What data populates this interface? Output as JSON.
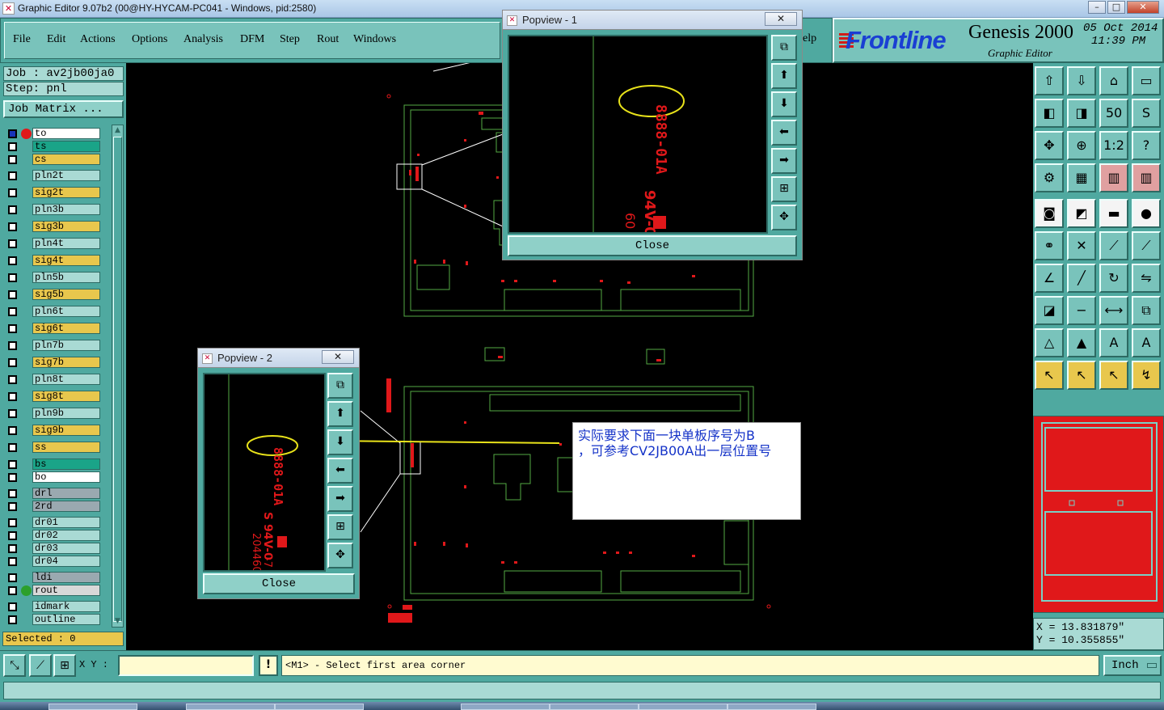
{
  "window": {
    "title": "Graphic Editor 9.07b2 (00@HY-HYCAM-PC041 - Windows, pid:2580)",
    "controls": [
      "–",
      "□",
      "✕"
    ]
  },
  "menu": {
    "items": [
      "File",
      "Edit",
      "Actions",
      "Options",
      "Analysis",
      "DFM",
      "Step",
      "Rout",
      "Windows"
    ],
    "help_fragment": "elp"
  },
  "branding": {
    "logo": "Frontline",
    "product": "Genesis 2000",
    "subtitle": "Graphic Editor",
    "date": "05 Oct 2014",
    "time": "11:39 PM"
  },
  "job": {
    "job_label": "Job : av2jb00ja0",
    "step_label": "Step: pnl",
    "matrix_button": "Job Matrix ..."
  },
  "layers": [
    {
      "name": "to",
      "color": "#ffffff",
      "active": true,
      "dot": "#e0181a"
    },
    {
      "name": "ts",
      "color": "#1aa488",
      "active": false,
      "dot": ""
    },
    {
      "name": "cs",
      "color": "#e8c74d",
      "active": false,
      "dot": ""
    },
    {
      "name": "pln2t",
      "color": "#a9dad4",
      "active": false,
      "dot": ""
    },
    {
      "name": "sig2t",
      "color": "#e8c74d",
      "active": false,
      "dot": ""
    },
    {
      "name": "pln3b",
      "color": "#a9dad4",
      "active": false,
      "dot": ""
    },
    {
      "name": "sig3b",
      "color": "#e8c74d",
      "active": false,
      "dot": ""
    },
    {
      "name": "pln4t",
      "color": "#a9dad4",
      "active": false,
      "dot": ""
    },
    {
      "name": "sig4t",
      "color": "#e8c74d",
      "active": false,
      "dot": ""
    },
    {
      "name": "pln5b",
      "color": "#a9dad4",
      "active": false,
      "dot": ""
    },
    {
      "name": "sig5b",
      "color": "#e8c74d",
      "active": false,
      "dot": ""
    },
    {
      "name": "pln6t",
      "color": "#a9dad4",
      "active": false,
      "dot": ""
    },
    {
      "name": "sig6t",
      "color": "#e8c74d",
      "active": false,
      "dot": ""
    },
    {
      "name": "pln7b",
      "color": "#a9dad4",
      "active": false,
      "dot": ""
    },
    {
      "name": "sig7b",
      "color": "#e8c74d",
      "active": false,
      "dot": ""
    },
    {
      "name": "pln8t",
      "color": "#a9dad4",
      "active": false,
      "dot": ""
    },
    {
      "name": "sig8t",
      "color": "#e8c74d",
      "active": false,
      "dot": ""
    },
    {
      "name": "pln9b",
      "color": "#a9dad4",
      "active": false,
      "dot": ""
    },
    {
      "name": "sig9b",
      "color": "#e8c74d",
      "active": false,
      "dot": ""
    },
    {
      "name": "ss",
      "color": "#e8c74d",
      "active": false,
      "dot": ""
    },
    {
      "name": "bs",
      "color": "#1aa488",
      "active": false,
      "dot": ""
    },
    {
      "name": "bo",
      "color": "#ffffff",
      "active": false,
      "dot": ""
    },
    {
      "name": "drl",
      "color": "#9aa9b0",
      "active": false,
      "dot": ""
    },
    {
      "name": "2rd",
      "color": "#9aa9b0",
      "active": false,
      "dot": ""
    },
    {
      "name": "dr01",
      "color": "#a9dad4",
      "active": false,
      "dot": ""
    },
    {
      "name": "dr02",
      "color": "#a9dad4",
      "active": false,
      "dot": ""
    },
    {
      "name": "dr03",
      "color": "#a9dad4",
      "active": false,
      "dot": ""
    },
    {
      "name": "dr04",
      "color": "#a9dad4",
      "active": false,
      "dot": ""
    },
    {
      "name": "ldi",
      "color": "#9aa9b0",
      "active": false,
      "dot": ""
    },
    {
      "name": "rout",
      "color": "#d8d8d8",
      "active": false,
      "dot": "#2ca02c"
    },
    {
      "name": "idmark",
      "color": "#a9dad4",
      "active": false,
      "dot": ""
    },
    {
      "name": "outline",
      "color": "#a9dad4",
      "active": false,
      "dot": ""
    }
  ],
  "selected_label": "Selected : 0",
  "popview1": {
    "title": "Popview - 1",
    "close_label": "Close",
    "texts": {
      "code": "8888-01A",
      "ul": "94V-0",
      "num": "60"
    }
  },
  "popview2": {
    "title": "Popview - 2",
    "close_label": "Close",
    "texts": {
      "code": "8888-01A",
      "ul": "S 94V-0",
      "num": "204460",
      "rev": "-7"
    }
  },
  "note": {
    "line1": "实际要求下面一块单板序号为B",
    "line2": "，可参考CV2JB00A出一层位置号"
  },
  "coords": {
    "x": "X  =  13.831879\"",
    "y": "Y  =  10.355855\""
  },
  "bottom": {
    "xy_label": "X Y :",
    "xy_value": "",
    "warn": "!",
    "prompt": "<M1> - Select first area corner",
    "unit": "Inch"
  },
  "colors": {
    "panel": "#4fa9a0",
    "canvas": "#000000",
    "profile": "#55aa44",
    "copper": "#e0181a",
    "highlight": "#e8e21a"
  }
}
